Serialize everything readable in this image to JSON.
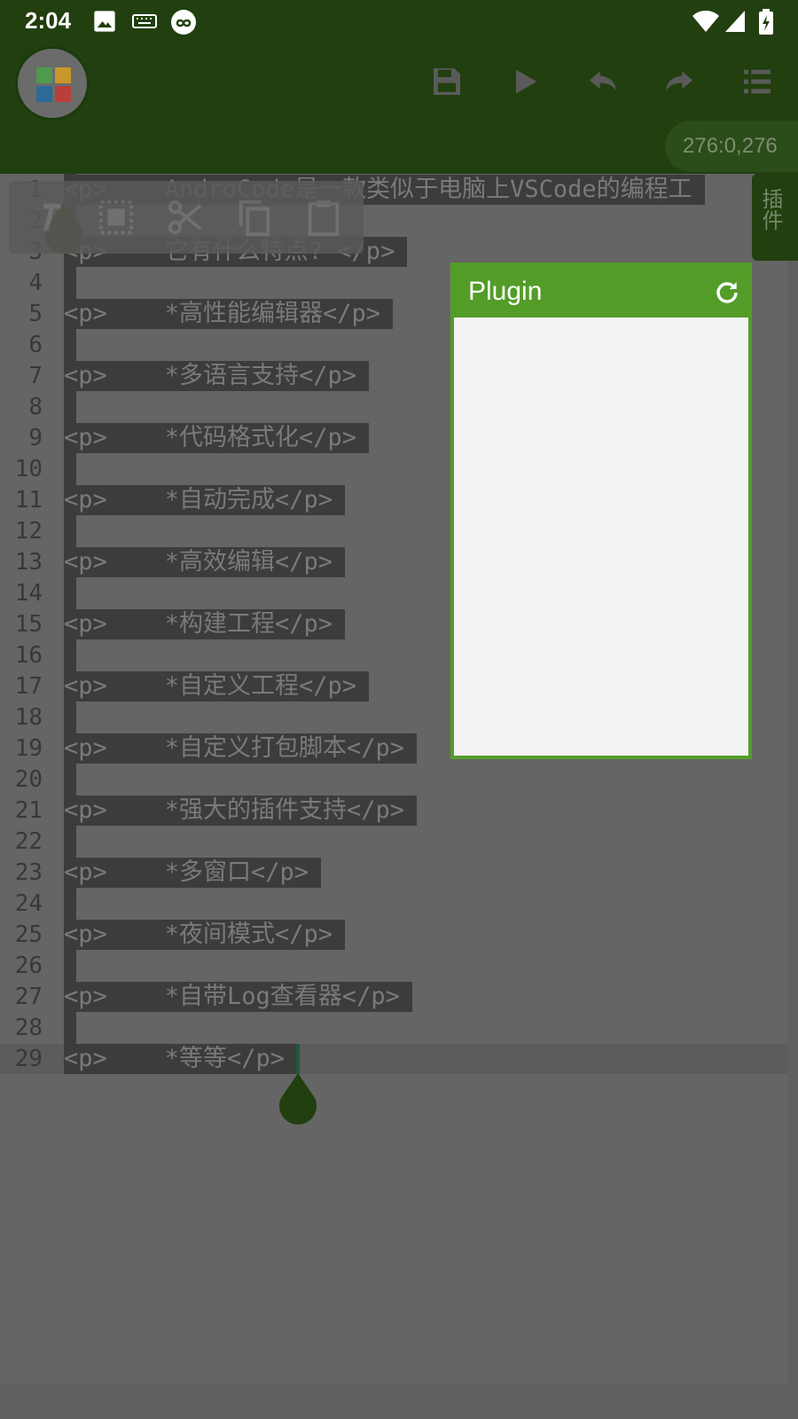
{
  "status_bar": {
    "time": "2:04",
    "icons": [
      "image-icon",
      "keyboard-icon",
      "infinity-icon",
      "wifi-icon",
      "signal-icon",
      "battery-charging-icon"
    ]
  },
  "toolbar": {
    "logo": "app-logo-icon",
    "buttons": [
      "save-icon",
      "run-icon",
      "undo-icon",
      "redo-icon",
      "menu-icon"
    ],
    "cursor_position": "276:0,276"
  },
  "selection_actions": [
    "text-format-icon",
    "select-all-icon",
    "cut-icon",
    "copy-icon",
    "paste-icon"
  ],
  "plugin_tab": {
    "label": "插件"
  },
  "plugin_panel": {
    "title": "Plugin",
    "refresh": "refresh-icon"
  },
  "editor": {
    "current_line": 29,
    "lines": [
      {
        "n": "1",
        "code": "<p>    AndroCode是一款类似于电脑上VSCode的编程工"
      },
      {
        "n": "2",
        "code": ""
      },
      {
        "n": "3",
        "code": "<p>    它有什么特点? </p>"
      },
      {
        "n": "4",
        "code": ""
      },
      {
        "n": "5",
        "code": "<p>    *高性能编辑器</p>"
      },
      {
        "n": "6",
        "code": ""
      },
      {
        "n": "7",
        "code": "<p>    *多语言支持</p>"
      },
      {
        "n": "8",
        "code": ""
      },
      {
        "n": "9",
        "code": "<p>    *代码格式化</p>"
      },
      {
        "n": "10",
        "code": ""
      },
      {
        "n": "11",
        "code": "<p>    *自动完成</p>"
      },
      {
        "n": "12",
        "code": ""
      },
      {
        "n": "13",
        "code": "<p>    *高效编辑</p>"
      },
      {
        "n": "14",
        "code": ""
      },
      {
        "n": "15",
        "code": "<p>    *构建工程</p>"
      },
      {
        "n": "16",
        "code": ""
      },
      {
        "n": "17",
        "code": "<p>    *自定义工程</p>"
      },
      {
        "n": "18",
        "code": ""
      },
      {
        "n": "19",
        "code": "<p>    *自定义打包脚本</p>"
      },
      {
        "n": "20",
        "code": ""
      },
      {
        "n": "21",
        "code": "<p>    *强大的插件支持</p>"
      },
      {
        "n": "22",
        "code": ""
      },
      {
        "n": "23",
        "code": "<p>    *多窗口</p>"
      },
      {
        "n": "24",
        "code": ""
      },
      {
        "n": "25",
        "code": "<p>    *夜间模式</p>"
      },
      {
        "n": "26",
        "code": ""
      },
      {
        "n": "27",
        "code": "<p>    *自带Log查看器</p>"
      },
      {
        "n": "28",
        "code": ""
      },
      {
        "n": "29",
        "code": "<p>    *等等</p>"
      }
    ]
  },
  "colors": {
    "toolbar": "#223f0f",
    "accent": "#539c28",
    "editor_bg": "#656565",
    "selection": "#3c3c3c"
  }
}
